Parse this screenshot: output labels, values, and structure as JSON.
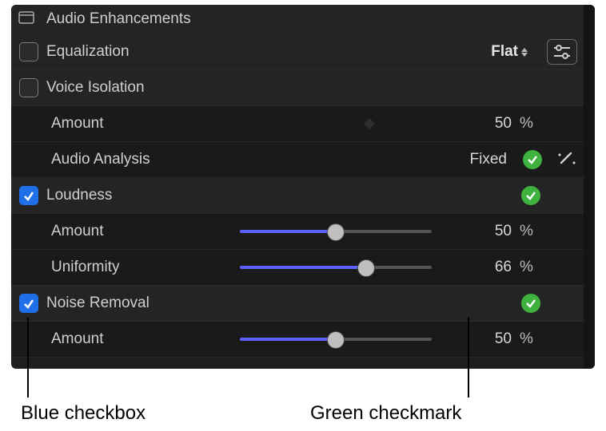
{
  "section": {
    "title": "Audio Enhancements"
  },
  "eq": {
    "label": "Equalization",
    "checked": false,
    "preset": "Flat"
  },
  "voice": {
    "label": "Voice Isolation",
    "checked": false,
    "amount": {
      "label": "Amount",
      "value": "50",
      "unit": "%"
    },
    "analysis": {
      "label": "Audio Analysis",
      "status": "Fixed"
    }
  },
  "loudness": {
    "label": "Loudness",
    "checked": true,
    "amount": {
      "label": "Amount",
      "value": "50",
      "unit": "%",
      "pct": 50
    },
    "uniformity": {
      "label": "Uniformity",
      "value": "66",
      "unit": "%",
      "pct": 66
    }
  },
  "noise": {
    "label": "Noise Removal",
    "checked": true,
    "amount": {
      "label": "Amount",
      "value": "50",
      "unit": "%",
      "pct": 50
    }
  },
  "annotations": {
    "blue": "Blue checkbox",
    "green": "Green checkmark"
  }
}
